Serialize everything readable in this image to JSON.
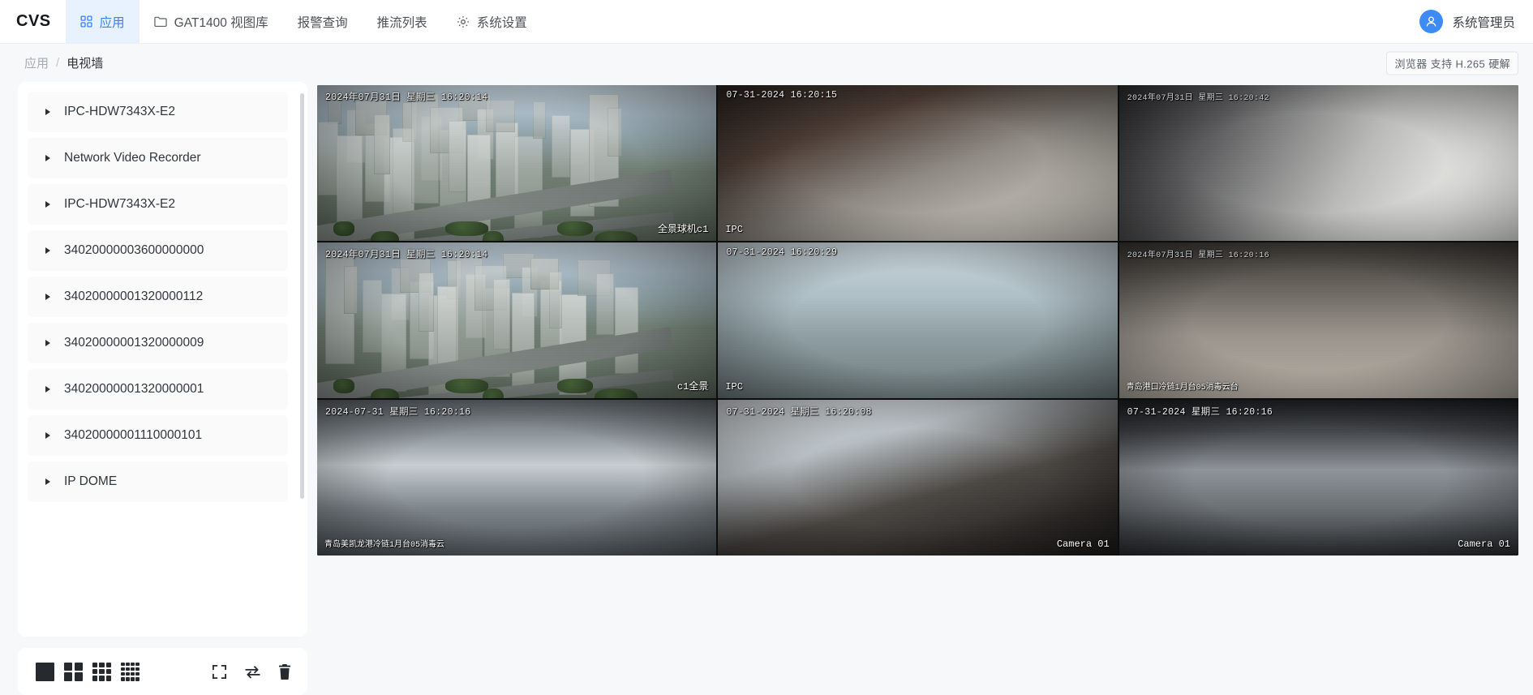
{
  "app": {
    "brand": "CVS",
    "user_name": "系统管理员"
  },
  "nav": {
    "items": [
      {
        "label": "应用",
        "icon": "grid-icon",
        "active": true
      },
      {
        "label": "GAT1400 视图库",
        "icon": "folder-icon",
        "active": false
      },
      {
        "label": "报警查询",
        "icon": "none",
        "active": false
      },
      {
        "label": "推流列表",
        "icon": "none",
        "active": false
      },
      {
        "label": "系统设置",
        "icon": "gear-icon",
        "active": false
      }
    ]
  },
  "breadcrumb": {
    "parent": "应用",
    "separator": "/",
    "current": "电视墙"
  },
  "status": {
    "h265_badge": "浏览器 支持 H.265 硬解"
  },
  "sidebar": {
    "items": [
      {
        "label": "IPC-HDW7343X-E2"
      },
      {
        "label": "Network Video Recorder"
      },
      {
        "label": "IPC-HDW7343X-E2"
      },
      {
        "label": "34020000003600000000"
      },
      {
        "label": "34020000001320000112"
      },
      {
        "label": "34020000001320000009"
      },
      {
        "label": "34020000001320000001"
      },
      {
        "label": "34020000001110000101"
      },
      {
        "label": "IP DOME"
      }
    ]
  },
  "toolbar": {
    "layouts": [
      {
        "name": "layout-1x1",
        "cells": 1,
        "selected": true
      },
      {
        "name": "layout-2x2",
        "cells": 4,
        "selected": false
      },
      {
        "name": "layout-3x3",
        "cells": 9,
        "selected": false
      },
      {
        "name": "layout-4x4",
        "cells": 16,
        "selected": false
      }
    ],
    "fullscreen_label": "全屏",
    "loop_label": "轮巡",
    "clear_label": "清空"
  },
  "video_wall": {
    "layout": "3x3",
    "tiles": [
      {
        "time": "2024年07月31日  星期三  16:20:14",
        "name": "全景球机c1",
        "scene": "sky-city",
        "name_pos": "right"
      },
      {
        "time": "07-31-2024 16:20:15",
        "name": "IPC",
        "scene": "indoor-red",
        "name_pos": "left"
      },
      {
        "time": "2024年07月31日 星期三 16:20:42",
        "name": "",
        "scene": "corridor",
        "name_pos": "left"
      },
      {
        "time": "2024年07月31日 星期三 16:20:14",
        "name": "c1全景",
        "scene": "sky-city-2",
        "name_pos": "right"
      },
      {
        "time": "07-31-2024 16:20:29",
        "name": "IPC",
        "scene": "lobby",
        "name_pos": "left"
      },
      {
        "time": "2024年07月31日 星期三 16:20:16",
        "name": "青岛港口冷链1月台05消毒云台",
        "scene": "warehouse-bags",
        "name_pos": "left"
      },
      {
        "time": "2024-07-31  星期三  16:20:16",
        "name": "青岛美凯龙港冷链1月台05消毒云",
        "scene": "dock",
        "name_pos": "left"
      },
      {
        "time": "07-31-2024  星期三  16:20:08",
        "name": "Camera 01",
        "scene": "meeting",
        "name_pos": "right"
      },
      {
        "time": "07-31-2024  星期三  16:20:16",
        "name": "Camera 01",
        "scene": "office-wide",
        "name_pos": "right"
      }
    ]
  }
}
